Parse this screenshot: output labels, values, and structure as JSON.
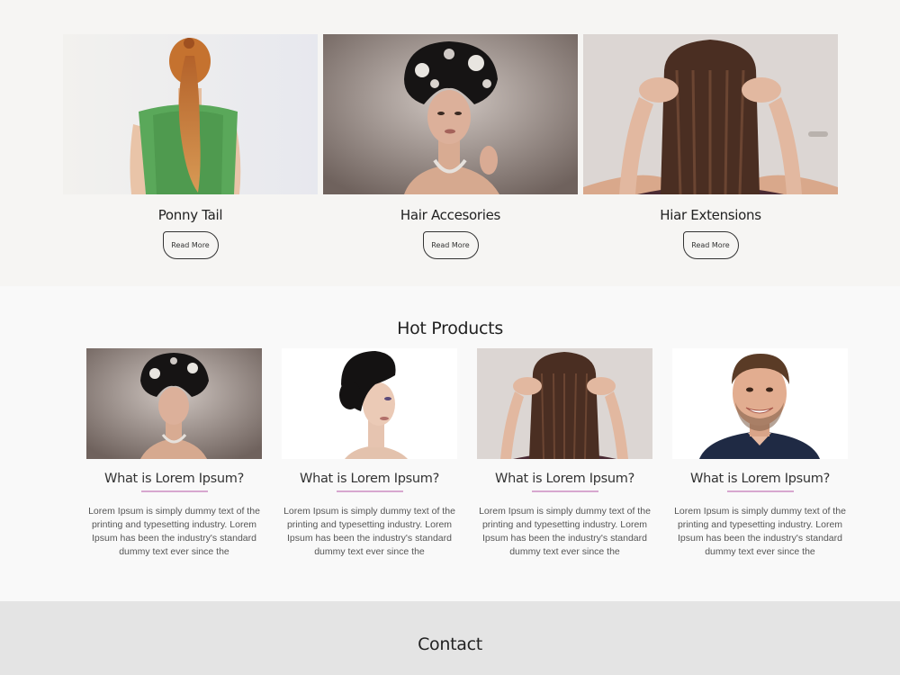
{
  "services": [
    {
      "title": "Ponny Tail",
      "button": "Read More",
      "image": "woman-ponytail-photo"
    },
    {
      "title": "Hair Accesories",
      "button": "Read More",
      "image": "woman-hair-jewels-photo"
    },
    {
      "title": "Hiar Extensions",
      "button": "Read More",
      "image": "hair-extension-photo"
    }
  ],
  "hot_products": {
    "heading": "Hot Products",
    "items": [
      {
        "title": "What is Lorem Ipsum?",
        "text": "Lorem Ipsum is simply dummy text of the printing and typesetting industry. Lorem Ipsum has been the industry's standard dummy text ever since the",
        "image": "woman-hair-jewels-photo"
      },
      {
        "title": "What is Lorem Ipsum?",
        "text": "Lorem Ipsum is simply dummy text of the printing and typesetting industry. Lorem Ipsum has been the industry's standard dummy text ever since the",
        "image": "woman-updo-photo"
      },
      {
        "title": "What is Lorem Ipsum?",
        "text": "Lorem Ipsum is simply dummy text of the printing and typesetting industry. Lorem Ipsum has been the industry's standard dummy text ever since the",
        "image": "hair-extension-photo"
      },
      {
        "title": "What is Lorem Ipsum?",
        "text": "Lorem Ipsum is simply dummy text of the printing and typesetting industry. Lorem Ipsum has been the industry's standard dummy text ever since the",
        "image": "smiling-man-photo"
      }
    ]
  },
  "contact": {
    "heading": "Contact"
  },
  "colors": {
    "accent_underline": "#d7a7cf",
    "section_bg": "#f6f5f3",
    "contact_bg": "#e4e4e4"
  }
}
